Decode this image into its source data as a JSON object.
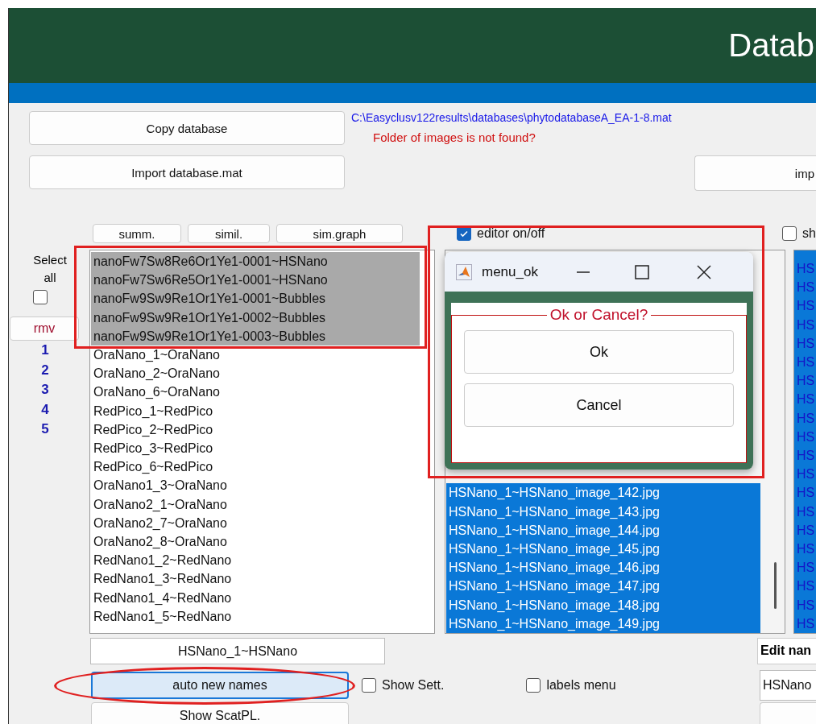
{
  "header": {
    "title": "Datab"
  },
  "copy_button": "Copy database",
  "import_button": "Import database.mat",
  "import_right_button": "imp",
  "path": "C:\\Easyclusv122results\\databases\\phytodatabaseA_EA-1-8.mat",
  "warning": "Folder of images is not found?",
  "toolbar": [
    "summ.",
    "simil.",
    "sim.graph"
  ],
  "editor_toggle": {
    "label": "editor on/off",
    "checked": true
  },
  "show_toggle": {
    "label": "sh",
    "checked": false
  },
  "select_all": {
    "label": "Select all",
    "checked": false
  },
  "remove_button": "rmv",
  "row_numbers": [
    "1",
    "2",
    "3",
    "4",
    "5"
  ],
  "class_list": [
    {
      "text": "nanoFw7Sw8Re6Or1Ye1-0001~HSNano",
      "selected": true
    },
    {
      "text": "nanoFw7Sw6Re5Or1Ye1-0001~HSNano",
      "selected": true
    },
    {
      "text": "nanoFw9Sw9Re1Or1Ye1-0001~Bubbles",
      "selected": true
    },
    {
      "text": "nanoFw9Sw9Re1Or1Ye1-0002~Bubbles",
      "selected": true
    },
    {
      "text": "nanoFw9Sw9Re1Or1Ye1-0003~Bubbles",
      "selected": true
    },
    {
      "text": "OraNano_1~OraNano",
      "selected": false
    },
    {
      "text": "OraNano_2~OraNano",
      "selected": false
    },
    {
      "text": "OraNano_6~OraNano",
      "selected": false
    },
    {
      "text": "RedPico_1~RedPico",
      "selected": false
    },
    {
      "text": "RedPico_2~RedPico",
      "selected": false
    },
    {
      "text": "RedPico_3~RedPico",
      "selected": false
    },
    {
      "text": "RedPico_6~RedPico",
      "selected": false
    },
    {
      "text": "OraNano1_3~OraNano",
      "selected": false
    },
    {
      "text": "OraNano2_1~OraNano",
      "selected": false
    },
    {
      "text": "OraNano2_7~OraNano",
      "selected": false
    },
    {
      "text": "OraNano2_8~OraNano",
      "selected": false
    },
    {
      "text": "RedNano1_2~RedNano",
      "selected": false
    },
    {
      "text": "RedNano1_3~RedNano",
      "selected": false
    },
    {
      "text": "RedNano1_4~RedNano",
      "selected": false
    },
    {
      "text": "RedNano1_5~RedNano",
      "selected": false
    }
  ],
  "image_list": [
    {
      "text": "HSNano_1~HSNano_image_142.jpg",
      "selected": true
    },
    {
      "text": "HSNano_1~HSNano_image_143.jpg",
      "selected": true
    },
    {
      "text": "HSNano_1~HSNano_image_144.jpg",
      "selected": true
    },
    {
      "text": "HSNano_1~HSNano_image_145.jpg",
      "selected": true
    },
    {
      "text": "HSNano_1~HSNano_image_146.jpg",
      "selected": true
    },
    {
      "text": "HSNano_1~HSNano_image_147.jpg",
      "selected": true
    },
    {
      "text": "HSNano_1~HSNano_image_148.jpg",
      "selected": true
    },
    {
      "text": "HSNano_1~HSNano_image_149.jpg",
      "selected": true
    }
  ],
  "third_list": [
    {
      "text": "HS",
      "selected": true
    },
    {
      "text": "HS",
      "selected": true
    },
    {
      "text": "HS",
      "selected": true
    },
    {
      "text": "HS",
      "selected": true
    },
    {
      "text": "HS",
      "selected": true
    },
    {
      "text": "HS",
      "selected": true
    },
    {
      "text": "HS",
      "selected": true
    },
    {
      "text": "HS",
      "selected": true
    },
    {
      "text": "HS",
      "selected": true
    },
    {
      "text": "HS",
      "selected": true
    },
    {
      "text": "HS",
      "selected": true
    },
    {
      "text": "HS",
      "selected": true
    },
    {
      "text": "HS",
      "selected": true
    },
    {
      "text": "HS",
      "selected": true
    },
    {
      "text": "HS",
      "selected": true
    },
    {
      "text": "HS",
      "selected": true
    },
    {
      "text": "HS",
      "selected": true
    },
    {
      "text": "HS",
      "selected": true
    },
    {
      "text": "HS",
      "selected": true
    },
    {
      "text": "HS",
      "selected": true
    }
  ],
  "name_field": {
    "value": "HSNano_1~HSNano"
  },
  "auto_names_button": {
    "label": "auto new names",
    "focused": true
  },
  "show_settings": {
    "label": "Show Sett.",
    "checked": false
  },
  "labels_menu": {
    "label": "labels menu",
    "checked": false
  },
  "edit_name": {
    "label": "Edit nan",
    "value": "HSNano"
  },
  "scatter_button": "Show ScatPL.",
  "dialog": {
    "title": "menu_ok",
    "legend": "Ok or Cancel?",
    "buttons": [
      "Ok",
      "Cancel"
    ]
  }
}
